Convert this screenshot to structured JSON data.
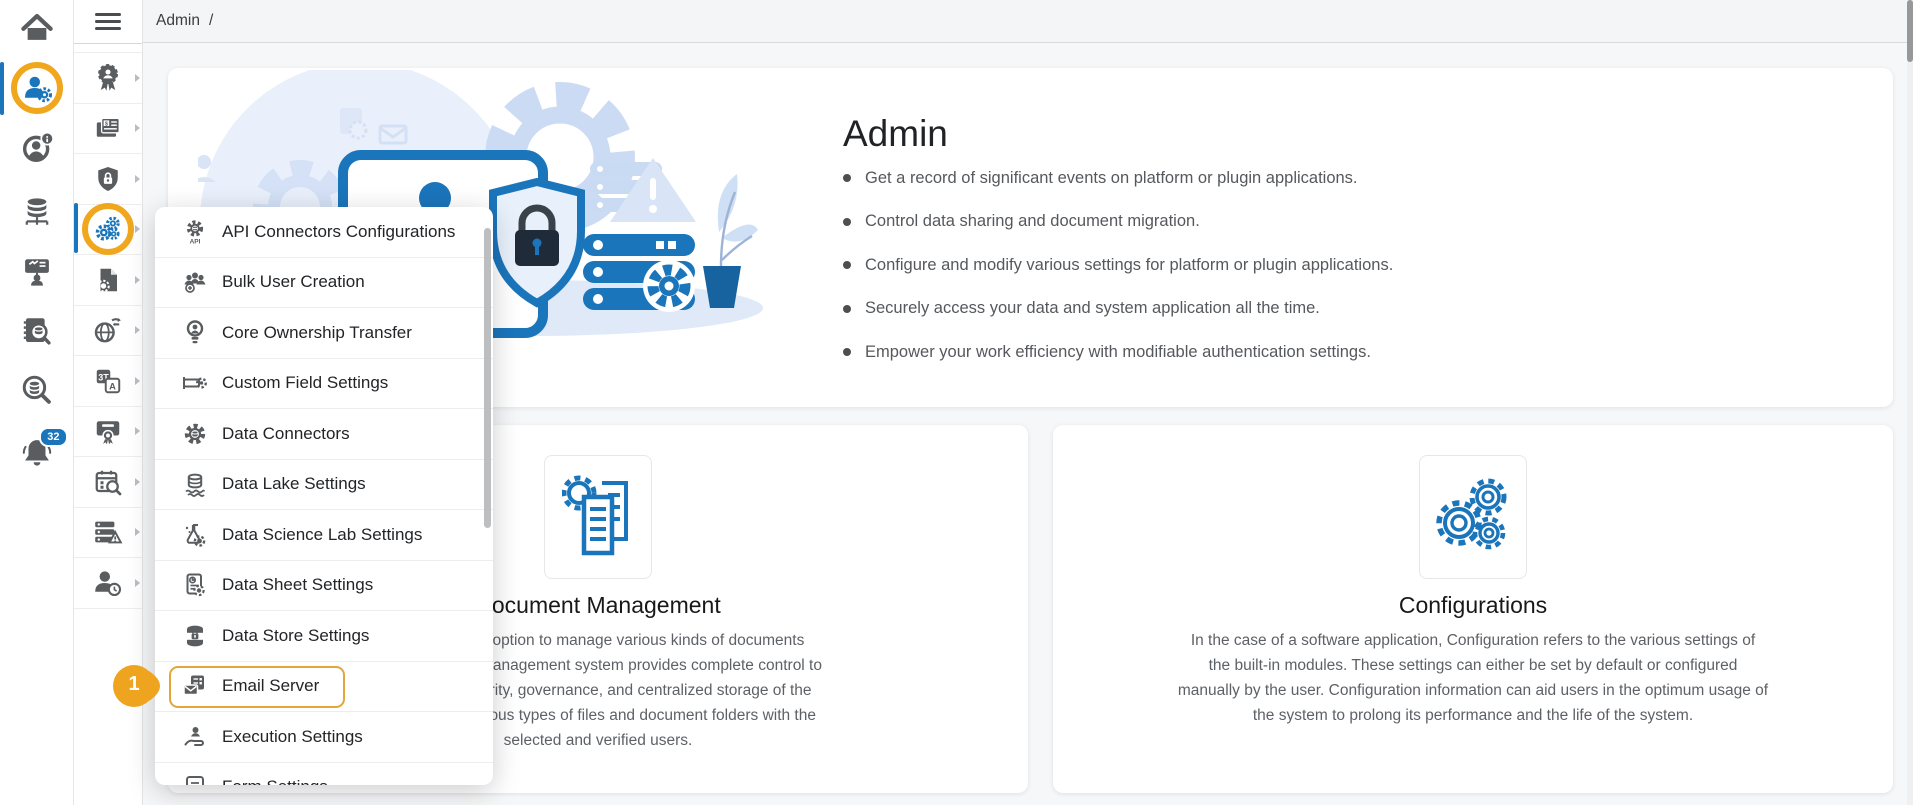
{
  "topbar": {
    "breadcrumb": "Admin",
    "separator": "/"
  },
  "primary_sidebar": {
    "items": [
      {
        "icon": "home-icon"
      },
      {
        "icon": "user-admin-settings-icon",
        "active": true
      },
      {
        "icon": "user-info-icon"
      },
      {
        "icon": "database-network-icon"
      },
      {
        "icon": "training-board-icon"
      },
      {
        "icon": "audit-document-search-icon"
      },
      {
        "icon": "data-search-icon"
      },
      {
        "icon": "notification-bell-icon",
        "badge": "32"
      }
    ]
  },
  "secondary_sidebar": {
    "items": [
      {
        "icon": "certification-badge-icon"
      },
      {
        "icon": "billing-invoice-icon"
      },
      {
        "icon": "security-shield-icon"
      },
      {
        "icon": "admin-gears-icon",
        "active": true
      },
      {
        "icon": "file-settings-icon"
      },
      {
        "icon": "data-migration-globe-icon"
      },
      {
        "icon": "language-translation-icon"
      },
      {
        "icon": "certificate-icon"
      },
      {
        "icon": "schedule-search-icon"
      },
      {
        "icon": "system-alert-icon"
      },
      {
        "icon": "user-session-clock-icon"
      }
    ]
  },
  "settings_menu": {
    "step_badge": "1",
    "items": [
      {
        "label": "API Connectors Configurations",
        "icon": "api-connector-icon"
      },
      {
        "label": "Bulk User Creation",
        "icon": "bulk-users-icon"
      },
      {
        "label": "Core Ownership Transfer",
        "icon": "ownership-bulb-icon"
      },
      {
        "label": "Custom Field Settings",
        "icon": "custom-field-icon"
      },
      {
        "label": "Data Connectors",
        "icon": "data-connector-gear-icon"
      },
      {
        "label": "Data Lake Settings",
        "icon": "data-lake-icon"
      },
      {
        "label": "Data Science Lab Settings",
        "icon": "data-science-flask-icon"
      },
      {
        "label": "Data Sheet Settings",
        "icon": "data-sheet-icon"
      },
      {
        "label": "Data Store Settings",
        "icon": "data-store-lock-icon"
      },
      {
        "label": "Email Server",
        "icon": "email-server-icon",
        "highlighted": true
      },
      {
        "label": "Execution Settings",
        "icon": "execution-hand-icon"
      },
      {
        "label": "Form Settings",
        "icon": "form-settings-icon",
        "clipped": true
      }
    ]
  },
  "hero": {
    "title": "Admin",
    "bullets": [
      "Get a record of significant events on platform or plugin applications.",
      "Control data sharing and document migration.",
      "Configure and modify various settings for platform or plugin applications.",
      "Securely access your data and system application all the time.",
      "Empower your work efficiency with modifiable authentication settings."
    ]
  },
  "cards": [
    {
      "title": "Document Management",
      "icon": "document-management-icon",
      "lines": [
        "Get an in-built option to manage various kinds of documents",
        "The Document Management system provides complete control to",
        "document security, governance, and centralized storage of the",
        "data. Share various types of files and document folders with the",
        "selected and verified users."
      ]
    },
    {
      "title": "Configurations",
      "icon": "configurations-gears-icon",
      "lines": [
        "In the case of a software application, Configuration refers to the various settings of",
        "the built-in modules. These settings can either be set by default or configured",
        "manually by the user. Configuration information can aid users in the optimum usage of",
        "the system to prolong its performance and the life of the system."
      ]
    }
  ],
  "colors": {
    "accent_blue": "#1b75bb",
    "accent_orange": "#f0a71e",
    "highlight_border": "#e2a63c",
    "icon_gray": "#5a5d60"
  }
}
